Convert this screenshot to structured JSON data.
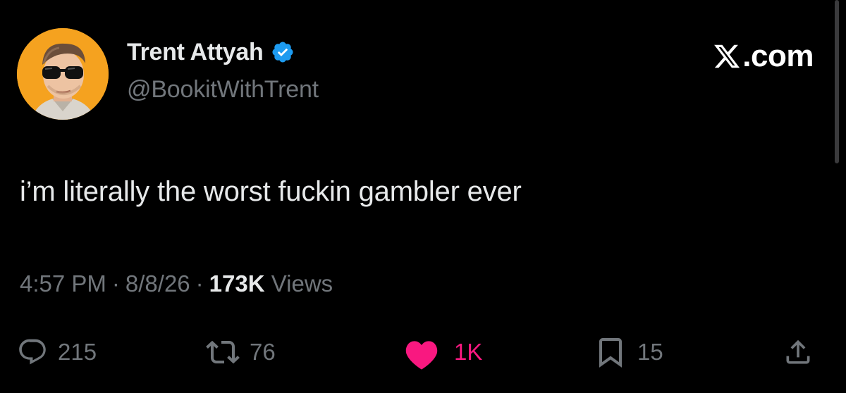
{
  "author": {
    "display_name": "Trent Attyah",
    "handle": "@BookitWithTrent",
    "verified": true,
    "avatar_bg": "#f5a21f"
  },
  "brand": {
    "icon": "x-logo-icon",
    "text": ".com"
  },
  "tweet": {
    "text": "i’m literally the worst fuckin gambler ever"
  },
  "meta": {
    "time": "4:57 PM",
    "sep1": "·",
    "date": "8/8/26",
    "sep2": "·",
    "views_count": "173K",
    "views_label": "Views"
  },
  "actions": {
    "reply": {
      "icon": "reply-icon",
      "count": "215"
    },
    "retweet": {
      "icon": "retweet-icon",
      "count": "76"
    },
    "like": {
      "icon": "heart-icon",
      "count": "1K",
      "active": true
    },
    "bookmark": {
      "icon": "bookmark-icon",
      "count": "15"
    },
    "share": {
      "icon": "share-icon"
    }
  },
  "colors": {
    "background": "#000000",
    "text_primary": "#e7e9ea",
    "text_secondary": "#71767b",
    "verified_blue": "#1d9bf0",
    "like_pink": "#f91880"
  }
}
